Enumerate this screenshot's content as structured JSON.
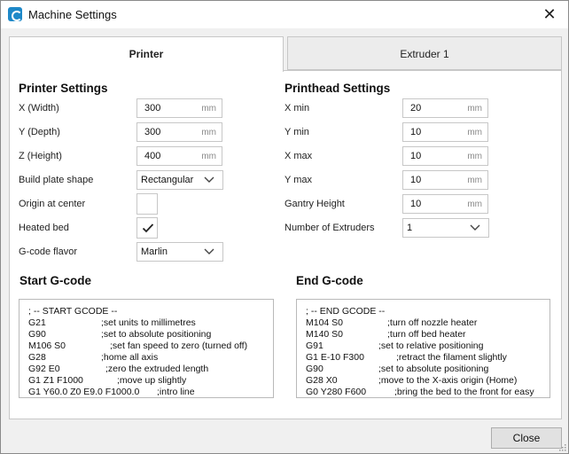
{
  "window": {
    "title": "Machine Settings",
    "close_glyph": "✕"
  },
  "tabs": [
    {
      "label": "Printer",
      "selected": true
    },
    {
      "label": "Extruder 1",
      "selected": false
    }
  ],
  "printer_settings": {
    "title": "Printer Settings",
    "x_width": {
      "label": "X (Width)",
      "value": "300",
      "unit": "mm"
    },
    "y_depth": {
      "label": "Y (Depth)",
      "value": "300",
      "unit": "mm"
    },
    "z_height": {
      "label": "Z (Height)",
      "value": "400",
      "unit": "mm"
    },
    "build_plate_shape": {
      "label": "Build plate shape",
      "value": "Rectangular"
    },
    "origin_at_center": {
      "label": "Origin at center",
      "checked": false
    },
    "heated_bed": {
      "label": "Heated bed",
      "checked": true
    },
    "gcode_flavor": {
      "label": "G-code flavor",
      "value": "Marlin"
    }
  },
  "printhead_settings": {
    "title": "Printhead Settings",
    "x_min": {
      "label": "X min",
      "value": "20",
      "unit": "mm"
    },
    "y_min": {
      "label": "Y min",
      "value": "10",
      "unit": "mm"
    },
    "x_max": {
      "label": "X max",
      "value": "10",
      "unit": "mm"
    },
    "y_max": {
      "label": "Y max",
      "value": "10",
      "unit": "mm"
    },
    "gantry_height": {
      "label": "Gantry Height",
      "value": "10",
      "unit": "mm"
    },
    "number_of_extruders": {
      "label": "Number of Extruders",
      "value": "1"
    }
  },
  "start_gcode": {
    "title": "Start G-code",
    "lines": [
      {
        "cmd": "; -- START GCODE --",
        "comment": ""
      },
      {
        "cmd": "G21",
        "comment": ";set units to millimetres"
      },
      {
        "cmd": "G90",
        "comment": ";set to absolute positioning"
      },
      {
        "cmd": "M106 S0",
        "comment": ";set fan speed to zero (turned off)"
      },
      {
        "cmd": "G28",
        "comment": ";home all axis"
      },
      {
        "cmd": "G92 E0",
        "comment": ";zero the extruded length"
      },
      {
        "cmd": "G1 Z1 F1000",
        "comment": ";move up slightly"
      },
      {
        "cmd": "G1 Y60.0 Z0 E9.0 F1000.0",
        "comment": ";intro line"
      }
    ]
  },
  "end_gcode": {
    "title": "End G-code",
    "lines": [
      {
        "cmd": "; -- END GCODE --",
        "comment": ""
      },
      {
        "cmd": "M104 S0",
        "comment": ";turn off nozzle heater"
      },
      {
        "cmd": "M140 S0",
        "comment": ";turn off bed heater"
      },
      {
        "cmd": "G91",
        "comment": ";set to relative positioning"
      },
      {
        "cmd": "G1 E-10 F300",
        "comment": ";retract the filament slightly"
      },
      {
        "cmd": "G90",
        "comment": ";set to absolute positioning"
      },
      {
        "cmd": "G28 X0",
        "comment": ";move to the X-axis origin (Home)"
      },
      {
        "cmd": "G0 Y280 F600",
        "comment": ";bring the bed to the front for easy"
      }
    ]
  },
  "footer": {
    "close_label": "Close"
  },
  "colors": {
    "accent": "#1e88c8",
    "panel_border": "#c7c7c7",
    "window_bg": "#f0f0f0"
  },
  "icons": [
    "app-logo-icon",
    "close-icon",
    "chevron-down-icon",
    "checkmark-icon",
    "resize-grip-icon"
  ]
}
